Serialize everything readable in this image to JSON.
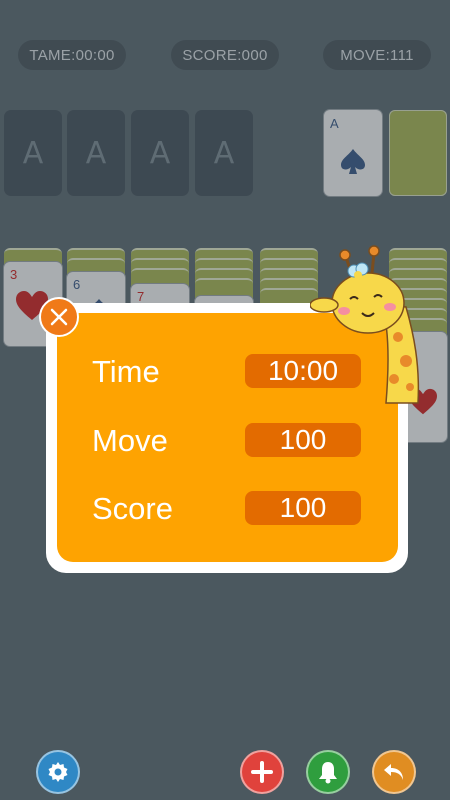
{
  "status_bar": {
    "time": "TAME:00:00",
    "score": "SCORE:000",
    "moves": "MOVE:111"
  },
  "foundations": [
    {
      "label": "A"
    },
    {
      "label": "A"
    },
    {
      "label": "A"
    },
    {
      "label": "A"
    }
  ],
  "waste_card": {
    "rank": "A",
    "suit": "spade"
  },
  "tableau": [
    {
      "top_rank": "3",
      "suit": "heart"
    },
    {
      "top_rank": "6",
      "suit": "spade"
    },
    {
      "top_rank": "7",
      "suit": "diamond"
    }
  ],
  "result_dialog": {
    "rows": [
      {
        "label": "Time",
        "value": "10:00"
      },
      {
        "label": "Move",
        "value": "100"
      },
      {
        "label": "Score",
        "value": "100"
      }
    ],
    "close_icon": "close-icon",
    "mascot": "giraffe"
  },
  "bottom_toolbar": {
    "buttons": [
      {
        "name": "settings",
        "icon": "gear-icon",
        "color": "#2f88c5"
      },
      {
        "name": "add",
        "icon": "plus-icon",
        "color": "#e0423c"
      },
      {
        "name": "hint",
        "icon": "bell-icon",
        "color": "#2f9e3e"
      },
      {
        "name": "undo",
        "icon": "undo-icon",
        "color": "#e08d22"
      }
    ]
  },
  "colors": {
    "background": "#5f6d76",
    "dialog": "#fea301",
    "value_box": "#e36b00",
    "card_back": "#a6b45a"
  }
}
